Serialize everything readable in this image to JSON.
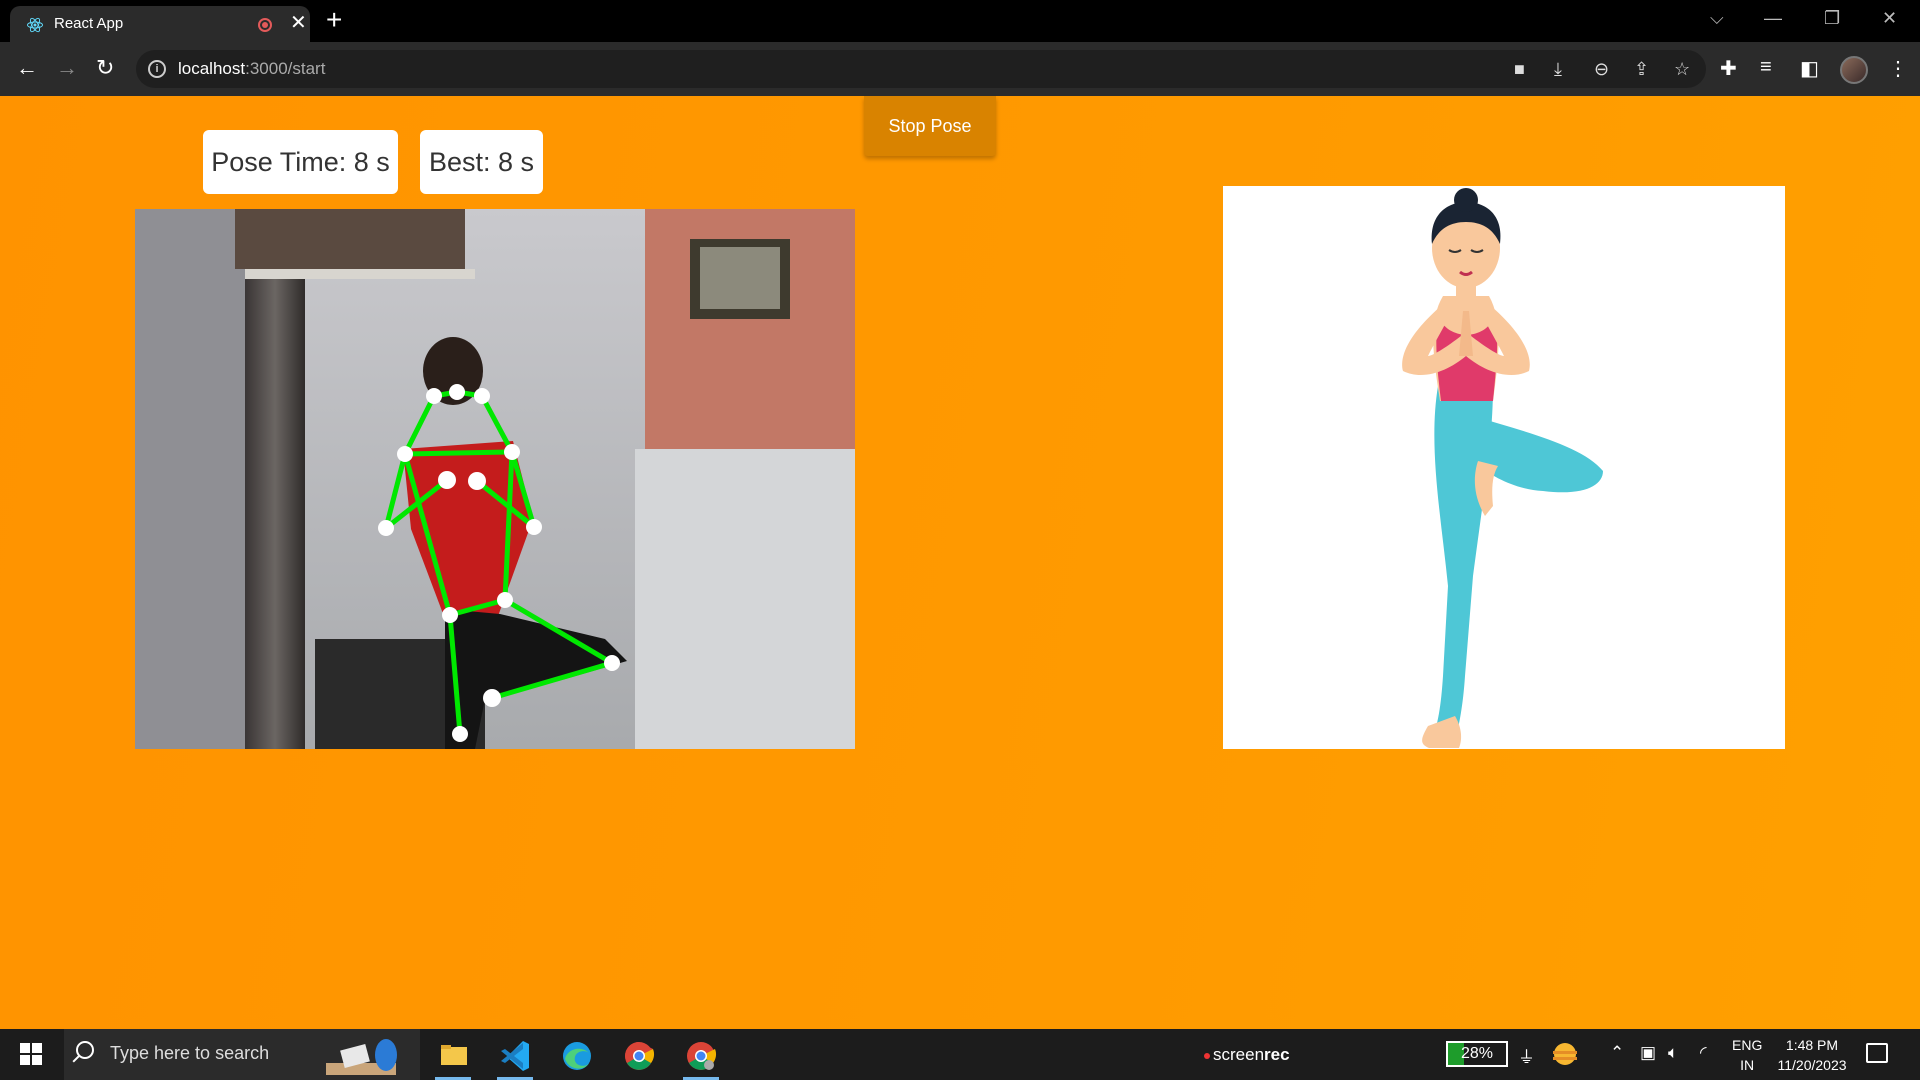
{
  "browser": {
    "tab": {
      "title": "React App",
      "close": "✕"
    },
    "new_tab": "+",
    "address": {
      "host": "localhost",
      "path": ":3000/start"
    },
    "window_controls": {
      "dropdown": "⌵",
      "minimize": "—",
      "restore": "❐",
      "close": "✕"
    }
  },
  "page": {
    "stop_button": "Stop Pose",
    "pose_time": "Pose Time: 8 s",
    "best": "Best: 8 s",
    "colors": {
      "background": "#ff9500",
      "skeleton": "#00e800",
      "joint": "#ffffff",
      "button": "#d98300"
    }
  },
  "taskbar": {
    "search_placeholder": "Type here to search",
    "screenrec": {
      "light": "screen",
      "bold": "rec"
    },
    "battery": {
      "label": "28%",
      "level": 0.28
    },
    "lang": {
      "line1": "ENG",
      "line2": "IN"
    },
    "clock": {
      "time": "1:48 PM",
      "date": "11/20/2023"
    }
  }
}
